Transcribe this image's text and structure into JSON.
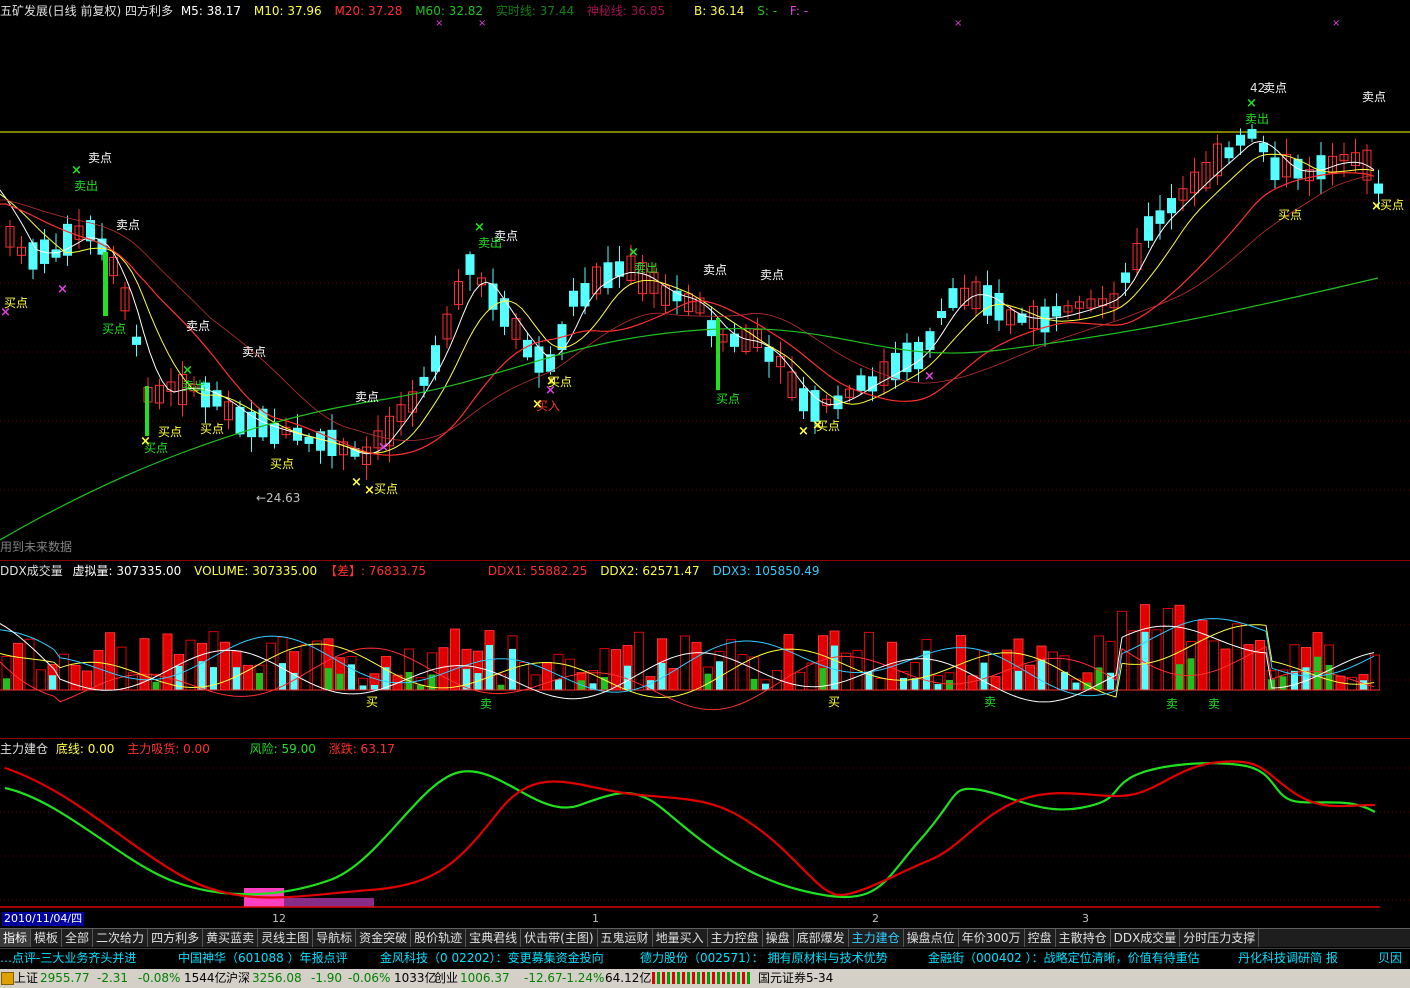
{
  "colors": {
    "up": "#ff3030",
    "down": "#55ffff",
    "ma5": "#ffffff",
    "ma10": "#ffff40",
    "ma20": "#ff3030",
    "ma60": "#20c020",
    "bg": "#000000",
    "grid": "#800000",
    "yellow_line": "#ffff00"
  },
  "price_header": {
    "title": "五矿发展(日线 前复权) 四方利多",
    "m5": "M5: 38.17",
    "m10": "M10: 37.96",
    "m20": "M20: 37.28",
    "m60": "M60: 32.82",
    "realtime": "实时线: 37.44",
    "secret": "神秘线: 36.85",
    "b": "B: 36.14",
    "s": "S: -",
    "f": "F: -"
  },
  "price_labels": {
    "high": "42",
    "low": "←24.63",
    "future_note": "用到未来数据",
    "sell_point": "卖点",
    "buy_point": "买点",
    "sell_out": "卖出",
    "buy_in": "买入"
  },
  "volume_header": {
    "label": "DDX成交量",
    "virtual": "虚拟量: 307335.00",
    "volume": "VOLUME: 307335.00",
    "diff": "【差】: 76833.75",
    "ddx1": "DDX1: 55882.25",
    "ddx2": "DDX2: 62571.47",
    "ddx3": "DDX3: 105850.49"
  },
  "volume_markers": {
    "buy": "买",
    "sell": "卖"
  },
  "ind_header": {
    "label": "主力建仓",
    "bottom": "底线: 0.00",
    "absorb": "主力吸货: 0.00",
    "risk": "风险: 59.00",
    "change": "涨跌: 63.17"
  },
  "date_axis": {
    "current": "2010/11/04/四",
    "m12": "12",
    "m1": "1",
    "m2": "2",
    "m3": "3"
  },
  "tabs": [
    {
      "label": "指标"
    },
    {
      "label": "模板"
    },
    {
      "label": "全部"
    },
    {
      "label": "二次给力"
    },
    {
      "label": "四方利多"
    },
    {
      "label": "黄买蓝卖"
    },
    {
      "label": "灵线主图"
    },
    {
      "label": "导航标"
    },
    {
      "label": "资金突破"
    },
    {
      "label": "股价轨迹"
    },
    {
      "label": "宝典君线"
    },
    {
      "label": "伏击带(主图)"
    },
    {
      "label": "五鬼运财"
    },
    {
      "label": "地量买入"
    },
    {
      "label": "主力控盘"
    },
    {
      "label": "操盘"
    },
    {
      "label": "底部爆发"
    },
    {
      "label": "主力建仓"
    },
    {
      "label": "操盘点位"
    },
    {
      "label": "年价300万"
    },
    {
      "label": "控盘"
    },
    {
      "label": "主散持仓"
    },
    {
      "label": "DDX成交量"
    },
    {
      "label": "分时压力支撑"
    }
  ],
  "news": [
    "…点评-三大业务齐头并进",
    "中国神华（601088 ）年报点评",
    "金风科技（0 02202）：变更募集资金投向",
    "德力股份（002571）：  拥有原材料与技术优势",
    "金融街（000402 ）：战略定位清晰，价值有待重估",
    "丹化科技调研简 报",
    "贝因美"
  ],
  "status": {
    "sh_label": "上证",
    "sh_value": "2955.77",
    "sh_change": "-2.31",
    "sh_pct": "-0.08%",
    "sh_amount": "1544亿",
    "hs_label": "沪深",
    "hs_value": "3256.08",
    "hs_change": "-1.90",
    "hs_pct": "-0.06%",
    "hs_amount": "1033亿",
    "cy_label": "创业",
    "cy_value": "1006.37",
    "cy_change": "-12.67",
    "cy_pct": "-1.24%",
    "cy_amount": "64.12亿",
    "broker": "国元证券5-34"
  }
}
